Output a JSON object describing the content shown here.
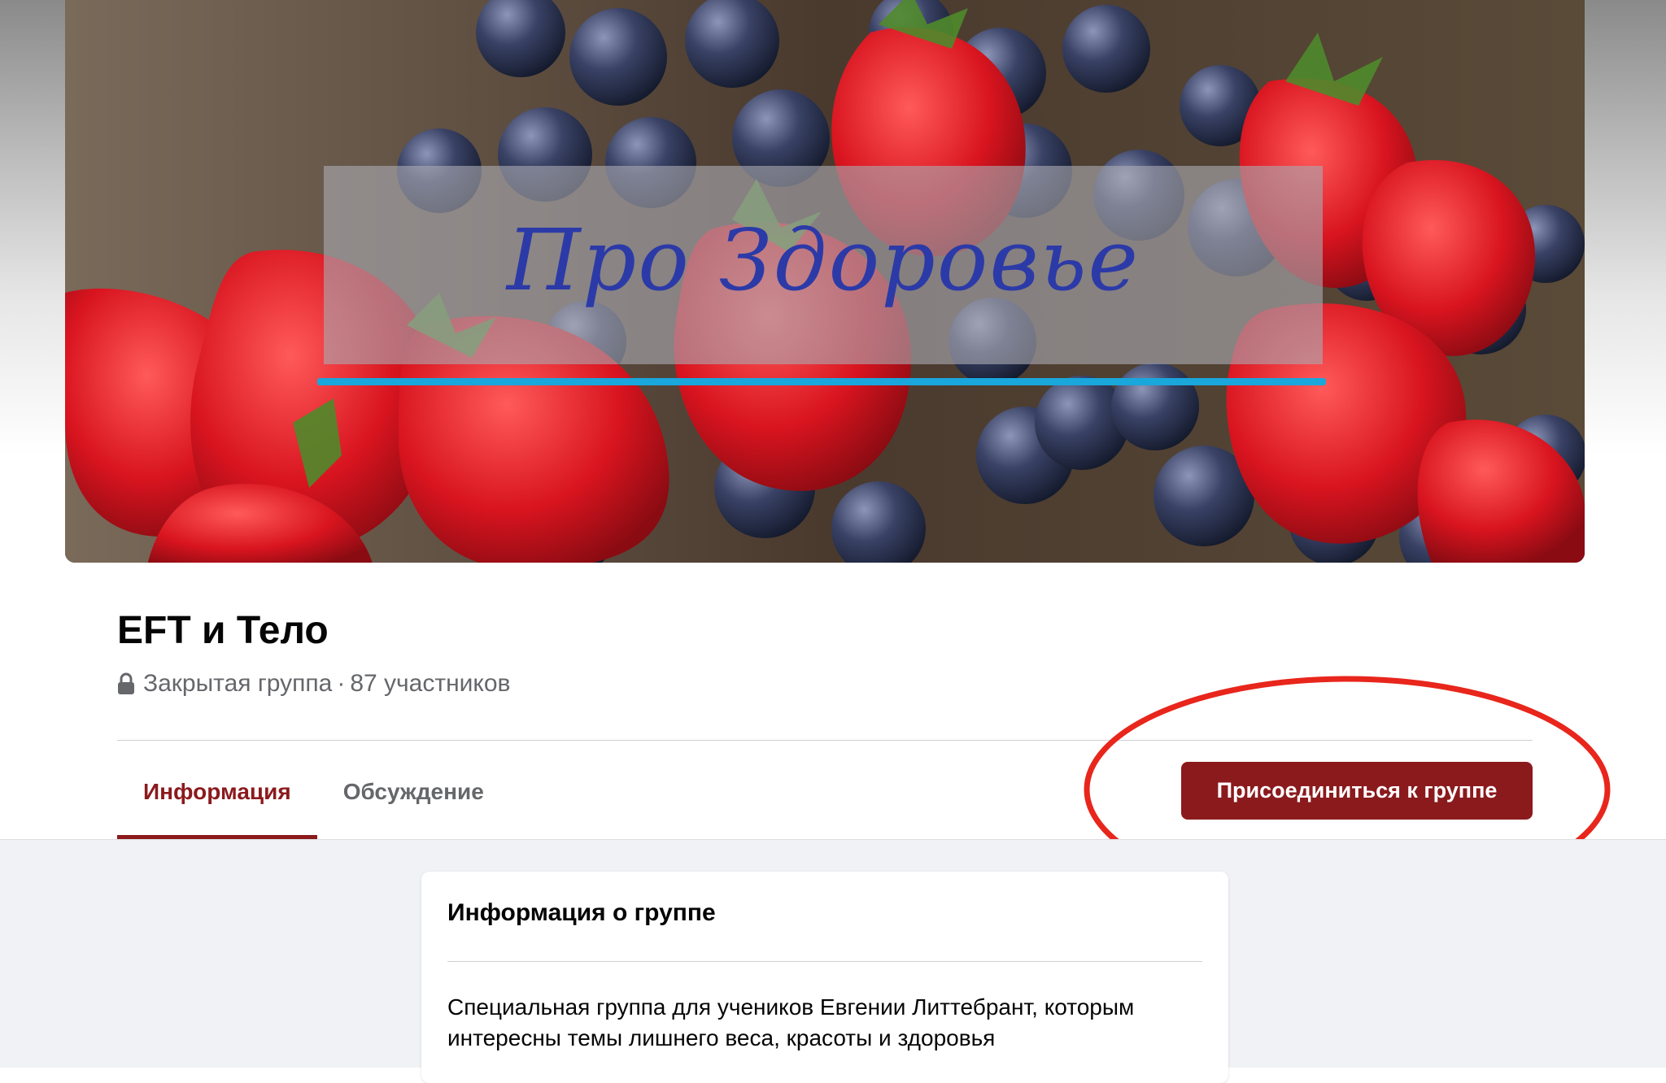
{
  "cover": {
    "banner_text": "Про Здоровье",
    "underline_color": "#19a7dc"
  },
  "group": {
    "name": "EFT и Тело",
    "privacy": "Закрытая группа",
    "separator": "·",
    "members": "87 участников"
  },
  "tabs": [
    {
      "label": "Информация",
      "active": true
    },
    {
      "label": "Обсуждение",
      "active": false
    }
  ],
  "join_button": {
    "label": "Присоединиться к группе"
  },
  "info_card": {
    "title": "Информация о группе",
    "description": "Специальная группа для учеников Евгении Литтебрант, которым интересны темы лишнего веса, красоты и здоровья"
  },
  "colors": {
    "brand": "#8b1a1d",
    "annotation": "#e8261c",
    "page_bg": "#f0f2f5"
  },
  "icons": {
    "lock": "lock-icon"
  }
}
